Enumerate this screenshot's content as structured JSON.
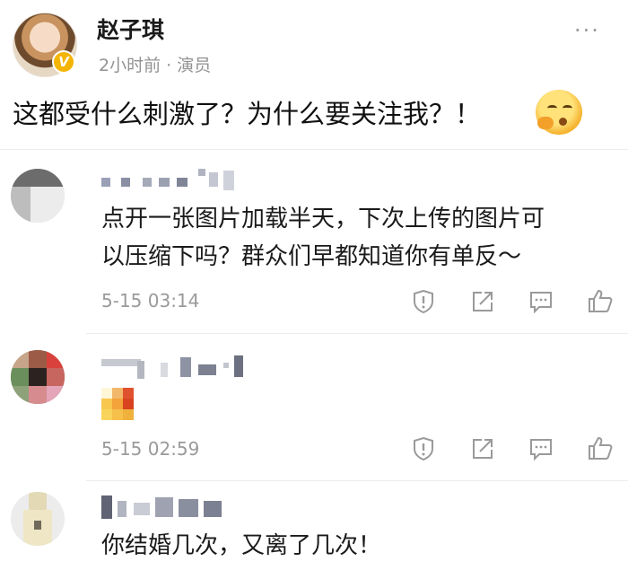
{
  "post": {
    "author": "赵子琪",
    "verified_symbol": "V",
    "meta": "2小时前 · 演员",
    "more_label": "···",
    "content": "这都受什么刺激了？为什么要关注我？！",
    "emoji": "shushing-face"
  },
  "comments": [
    {
      "text_lines": [
        "点开一张图片加载半天，下次上传的图片可",
        "以压缩下吗？群众们早都知道你有单反～"
      ],
      "time": "5-15 03:14",
      "actions": [
        "report-icon",
        "share-icon",
        "comment-icon",
        "like-icon"
      ]
    },
    {
      "text_lines": [],
      "sticker": "pixelated-emoji",
      "time": "5-15 02:59",
      "actions": [
        "report-icon",
        "share-icon",
        "comment-icon",
        "like-icon"
      ]
    },
    {
      "text_lines": [
        "你结婚几次，又离了几次！"
      ],
      "time": "",
      "actions": []
    }
  ],
  "colors": {
    "divider": "#ececec",
    "meta_text": "#939393",
    "icon_gray": "#9a9a9a",
    "verified_gold": "#f4b400"
  }
}
